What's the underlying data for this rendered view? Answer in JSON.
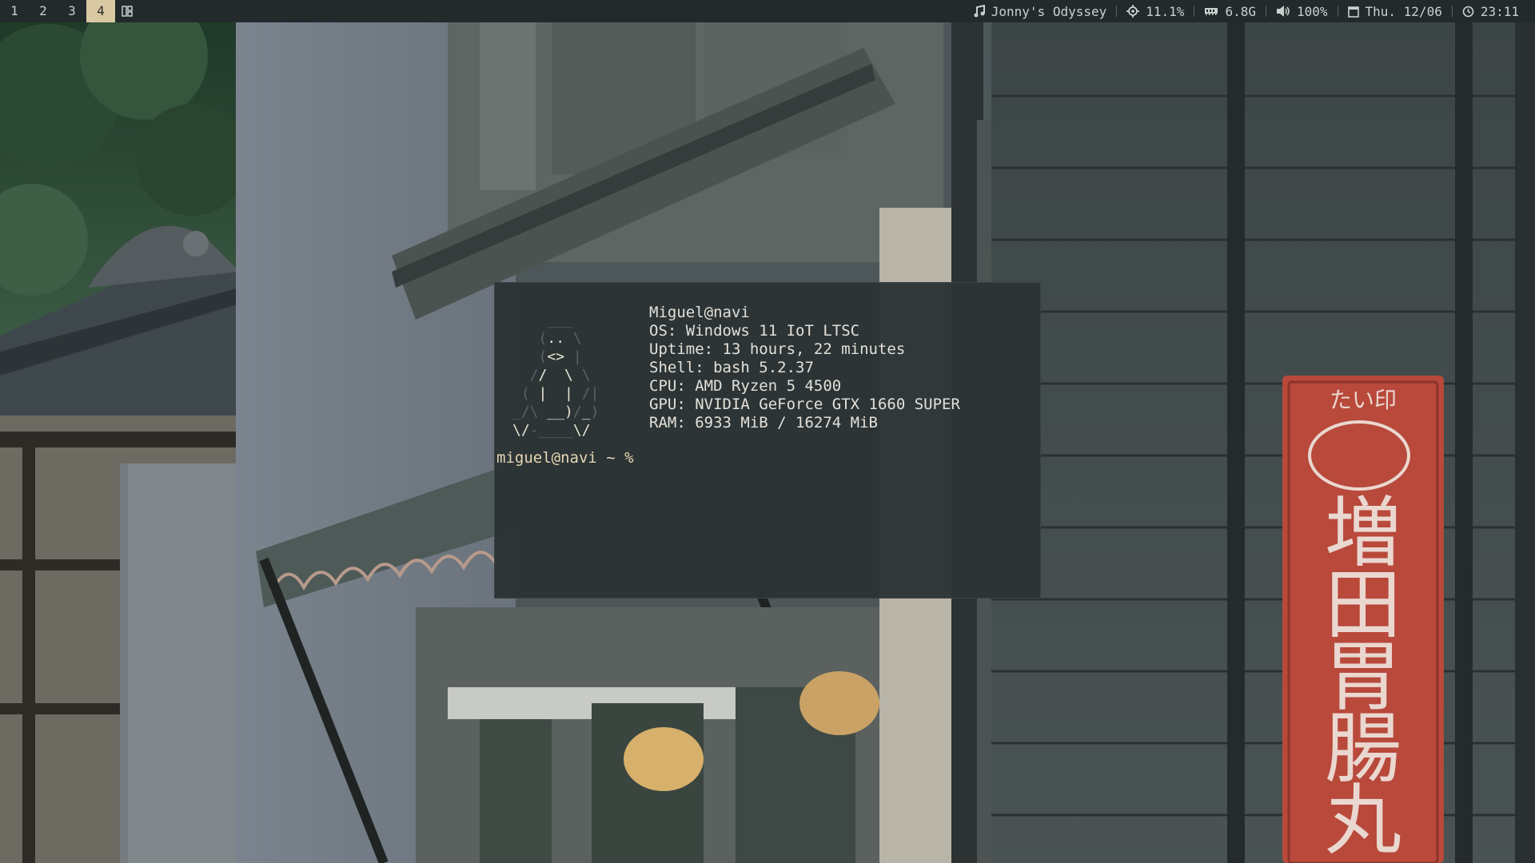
{
  "topbar": {
    "workspaces": [
      {
        "label": "1",
        "active": false
      },
      {
        "label": "2",
        "active": false
      },
      {
        "label": "3",
        "active": false
      },
      {
        "label": "4",
        "active": true
      }
    ],
    "layout_icon": "tiled-layout-icon",
    "music": {
      "icon": "music-note-icon",
      "text": "Jonny's Odyssey"
    },
    "cpu": {
      "icon": "cpu-icon",
      "text": "11.1%"
    },
    "memory": {
      "icon": "memory-icon",
      "text": "6.8G"
    },
    "volume": {
      "icon": "speaker-icon",
      "text": "100%"
    },
    "date": {
      "icon": "calendar-icon",
      "text": "Thu. 12/06"
    },
    "clock": {
      "icon": "clock-icon",
      "text": "23:11"
    },
    "colors": {
      "bar_bg": "#222a2c",
      "fg": "#c9d1cf",
      "active_ws_bg": "#d9c9a2"
    }
  },
  "terminal": {
    "info": {
      "header": "Miguel@navi",
      "os": "OS: Windows 11 IoT LTSC",
      "uptime": "Uptime: 13 hours, 22 minutes",
      "shell": "Shell: bash 5.2.37",
      "cpu": "CPU: AMD Ryzen 5 4500",
      "gpu": "GPU: NVIDIA GeForce GTX 1660 SUPER",
      "ram": "RAM: 6933 MiB / 16274 MiB"
    },
    "prompt": "miguel@navi ~ %",
    "colors": {
      "bg": "#2c3334",
      "fg": "#e2e1da",
      "prompt": "#e6d7b4"
    }
  },
  "wallpaper": {
    "description_icon": "wallpaper-image",
    "sign": {
      "top": "たい印",
      "chars": [
        "増",
        "田",
        "胃",
        "腸",
        "丸"
      ]
    }
  }
}
